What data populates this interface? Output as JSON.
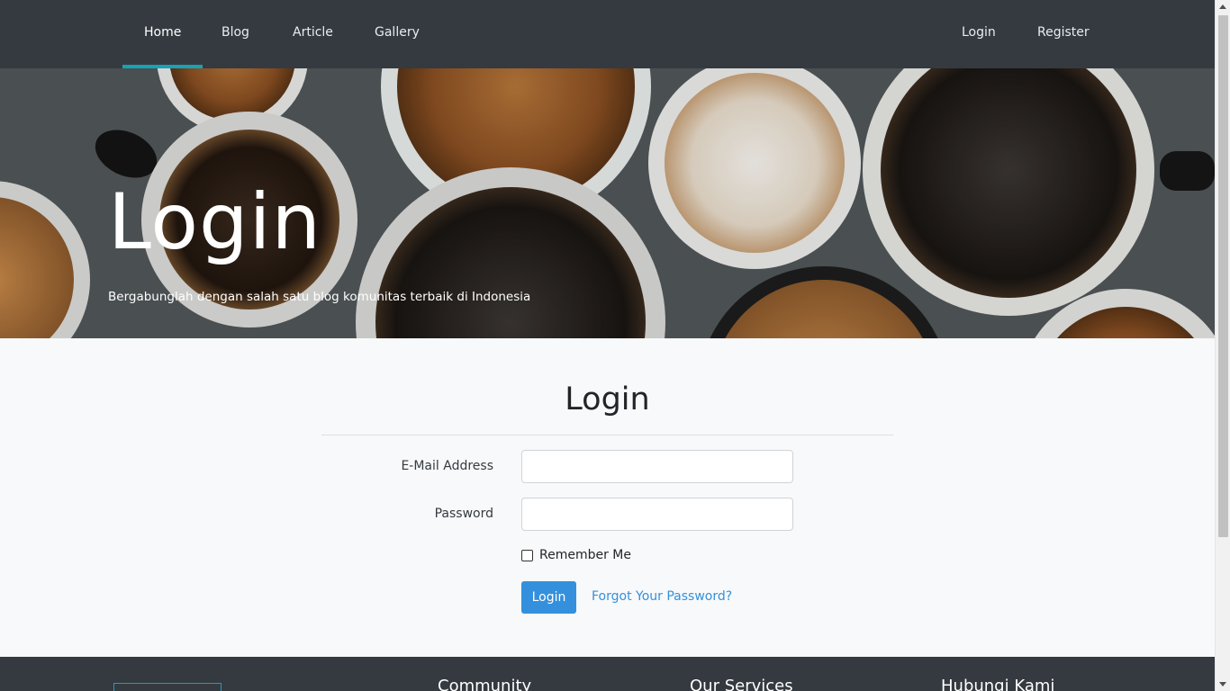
{
  "navbar": {
    "items": [
      {
        "label": "Home",
        "active": true
      },
      {
        "label": "Blog"
      },
      {
        "label": "Article"
      },
      {
        "label": "Gallery"
      }
    ],
    "auth": [
      {
        "label": "Login"
      },
      {
        "label": "Register"
      }
    ]
  },
  "hero": {
    "title": "Login",
    "subtitle": "Bergabunglah dengan salah satu blog komunitas terbaik di Indonesia",
    "background": "coffee-cups-photo"
  },
  "login_form": {
    "title": "Login",
    "email_label": "E-Mail Address",
    "email_value": "",
    "password_label": "Password",
    "password_value": "",
    "remember_label": "Remember Me",
    "remember_checked": false,
    "submit_label": "Login",
    "forgot_label": "Forgot Your Password?"
  },
  "footer": {
    "headings": [
      "Community",
      "Our Services",
      "Hubungi Kami"
    ]
  },
  "colors": {
    "navbar_bg": "#343a40",
    "accent": "#17a2b8",
    "primary_button": "#3490dc",
    "page_bg": "#f8f9fa"
  }
}
